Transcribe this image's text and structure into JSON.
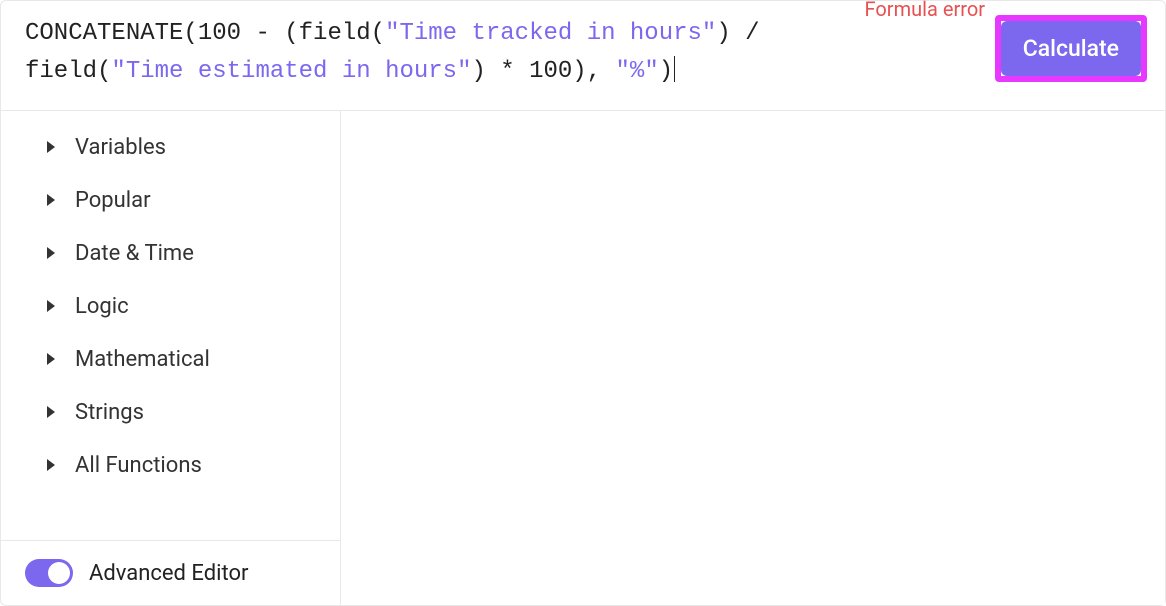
{
  "formula": {
    "tokens": [
      {
        "type": "fn",
        "text": "CONCATENATE(100 - (field("
      },
      {
        "type": "str",
        "text": "\"Time tracked in hours\""
      },
      {
        "type": "fn",
        "text": ") / "
      },
      {
        "type": "br"
      },
      {
        "type": "fn",
        "text": "field("
      },
      {
        "type": "str",
        "text": "\"Time estimated in hours\""
      },
      {
        "type": "fn",
        "text": ") * 100), "
      },
      {
        "type": "str",
        "text": "\"%\""
      },
      {
        "type": "fn",
        "text": ")"
      }
    ]
  },
  "error_text": "Formula error",
  "calculate_label": "Calculate",
  "categories": [
    {
      "label": "Variables"
    },
    {
      "label": "Popular"
    },
    {
      "label": "Date & Time"
    },
    {
      "label": "Logic"
    },
    {
      "label": "Mathematical"
    },
    {
      "label": "Strings"
    },
    {
      "label": "All Functions"
    }
  ],
  "advanced_editor_label": "Advanced Editor",
  "advanced_editor_on": true
}
